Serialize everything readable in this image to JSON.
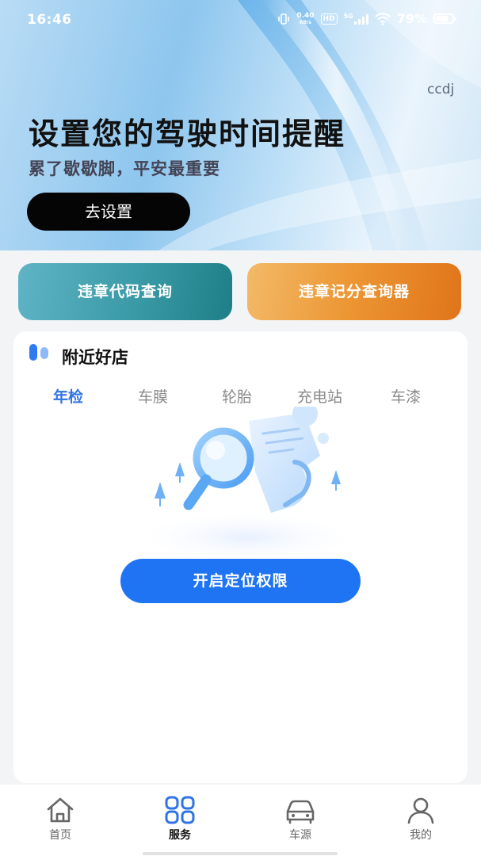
{
  "status_bar": {
    "time": "16:46",
    "net_speed_value": "0.40",
    "net_speed_unit": "KB/s",
    "hd_badge": "HD",
    "network_type": "5G",
    "battery_percent": "79%",
    "icons": [
      "vibrate-icon",
      "wifi-icon",
      "signal-icon",
      "battery-icon"
    ]
  },
  "banner": {
    "watermark": "ccdj",
    "title": "设置您的驾驶时间提醒",
    "subtitle": "累了歇歇脚，平安最重要",
    "button_label": "去设置"
  },
  "quick_actions": {
    "left_label": "违章代码查询",
    "right_label": "违章记分查询器"
  },
  "nearby": {
    "title": "附近好店",
    "tabs": [
      {
        "label": "年检",
        "active": true
      },
      {
        "label": "车膜",
        "active": false
      },
      {
        "label": "轮胎",
        "active": false
      },
      {
        "label": "充电站",
        "active": false
      },
      {
        "label": "车漆",
        "active": false
      }
    ],
    "illustration": "search-document-illustration",
    "location_button_label": "开启定位权限"
  },
  "bottom_nav": {
    "items": [
      {
        "label": "首页",
        "icon": "home-icon",
        "active": false
      },
      {
        "label": "服务",
        "icon": "grid-icon",
        "active": true
      },
      {
        "label": "车源",
        "icon": "car-icon",
        "active": false
      },
      {
        "label": "我的",
        "icon": "user-icon",
        "active": false
      }
    ]
  },
  "colors": {
    "accent_blue": "#1f74f4",
    "tab_active": "#2f73e6",
    "teal_button": "#3a9aa6",
    "orange_button": "#ec9532",
    "banner_button": "#050505"
  }
}
